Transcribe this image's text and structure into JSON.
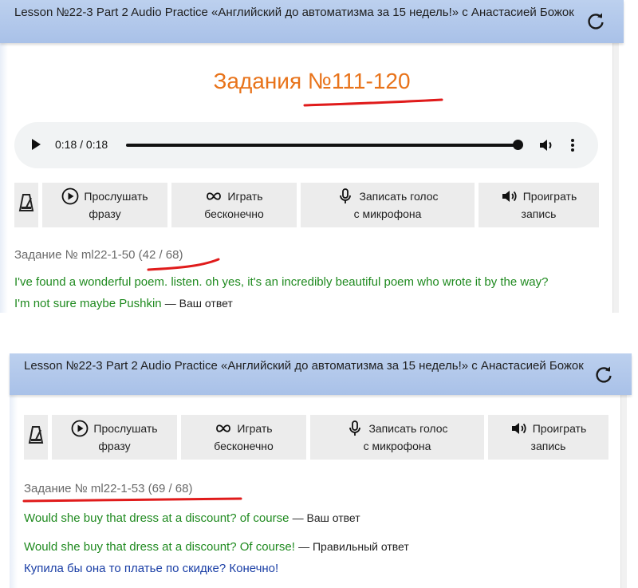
{
  "window": {
    "title": "Lesson №22-3 Part 2 Audio Practice «Английский до автоматизма за 15 недель!» с Анастасией Божок"
  },
  "panel1": {
    "heading": "Задания №111-120",
    "audio": {
      "time": "0:18 / 0:18",
      "progress": 1.0
    },
    "task": "Задание № ml22-1-50 (42 / 68)",
    "user_answer": "I've found a wonderful poem. listen. oh yes, it's an incredibly beautiful poem who wrote it by the way?",
    "user_answer_cont": "I'm not sure maybe Pushkin",
    "your_answer_tag": "— Ваш ответ"
  },
  "toolbar": {
    "listen_line1": "Прослушать",
    "listen_line2": "фразу",
    "loop_line1": "Играть",
    "loop_line2": "бесконечно",
    "record_line1": "Записать голос",
    "record_line2": "с микрофона",
    "playback_line1": "Проиграть",
    "playback_line2": "запись"
  },
  "panel2": {
    "task": "Задание № ml22-1-53 (69 / 68)",
    "user_answer": "Would she buy that dress at a discount? of course",
    "your_answer_tag": "— Ваш ответ",
    "correct_answer": "Would she buy that dress at a discount? Of course!",
    "correct_answer_tag": "— Правильный ответ",
    "translation": "Купила бы она то платье по скидке? Конечно!"
  },
  "icons": [
    "refresh-icon",
    "metronome-icon",
    "play-circle-icon",
    "infinity-icon",
    "microphone-icon",
    "speaker-icon",
    "volume-icon",
    "more-vert-icon"
  ],
  "colors": {
    "heading": "#e8731a",
    "answer": "#1f8a1f",
    "translation": "#1b3fa6",
    "underline": "#e01b1b",
    "titlebar": "#b3c8ec"
  }
}
